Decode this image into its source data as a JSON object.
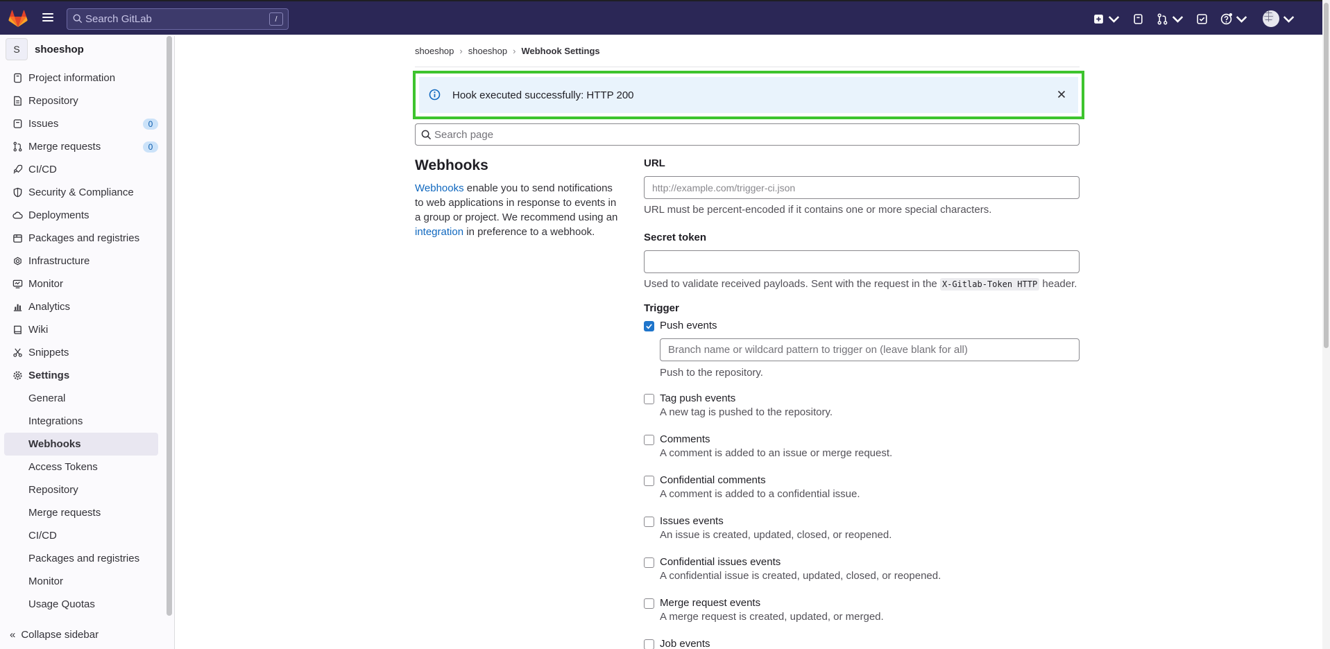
{
  "topbar": {
    "search_placeholder": "Search GitLab",
    "search_shortcut": "/"
  },
  "sidebar": {
    "project_avatar": "S",
    "project_name": "shoeshop",
    "items": [
      {
        "label": "Project information",
        "icon": "project-icon"
      },
      {
        "label": "Repository",
        "icon": "doc-icon"
      },
      {
        "label": "Issues",
        "icon": "issues-icon",
        "badge": "0"
      },
      {
        "label": "Merge requests",
        "icon": "merge-request-icon",
        "badge": "0"
      },
      {
        "label": "CI/CD",
        "icon": "rocket-icon"
      },
      {
        "label": "Security & Compliance",
        "icon": "shield-icon"
      },
      {
        "label": "Deployments",
        "icon": "cloud-icon"
      },
      {
        "label": "Packages and registries",
        "icon": "package-icon"
      },
      {
        "label": "Infrastructure",
        "icon": "infrastructure-icon"
      },
      {
        "label": "Monitor",
        "icon": "monitor-icon"
      },
      {
        "label": "Analytics",
        "icon": "chart-icon"
      },
      {
        "label": "Wiki",
        "icon": "book-icon"
      },
      {
        "label": "Snippets",
        "icon": "scissors-icon"
      },
      {
        "label": "Settings",
        "icon": "gear-icon"
      }
    ],
    "settings_sub": [
      "General",
      "Integrations",
      "Webhooks",
      "Access Tokens",
      "Repository",
      "Merge requests",
      "CI/CD",
      "Packages and registries",
      "Monitor",
      "Usage Quotas"
    ],
    "collapse_label": "Collapse sidebar"
  },
  "breadcrumb": {
    "items": [
      "shoeshop",
      "shoeshop",
      "Webhook Settings"
    ]
  },
  "alert": {
    "message": "Hook executed successfully: HTTP 200"
  },
  "page_search": {
    "placeholder": "Search page"
  },
  "intro": {
    "title": "Webhooks",
    "link1": "Webhooks",
    "text1": " enable you to send notifications to web applications in response to events in a group or project. We recommend using an ",
    "link2": "integration",
    "text2": " in preference to a webhook."
  },
  "form": {
    "url_label": "URL",
    "url_placeholder": "http://example.com/trigger-ci.json",
    "url_help": "URL must be percent-encoded if it contains one or more special characters.",
    "token_label": "Secret token",
    "token_help_pre": "Used to validate received payloads. Sent with the request in the",
    "token_help_code": "X-Gitlab-Token HTTP",
    "token_help_post": "header.",
    "trigger_label": "Trigger",
    "push_title": "Push events",
    "push_branch_placeholder": "Branch name or wildcard pattern to trigger on (leave blank for all)",
    "push_desc": "Push to the repository.",
    "events": [
      {
        "title": "Tag push events",
        "desc": "A new tag is pushed to the repository.",
        "checked": false
      },
      {
        "title": "Comments",
        "desc": "A comment is added to an issue or merge request.",
        "checked": false
      },
      {
        "title": "Confidential comments",
        "desc": "A comment is added to a confidential issue.",
        "checked": false
      },
      {
        "title": "Issues events",
        "desc": "An issue is created, updated, closed, or reopened.",
        "checked": false
      },
      {
        "title": "Confidential issues events",
        "desc": "A confidential issue is created, updated, closed, or reopened.",
        "checked": false
      },
      {
        "title": "Merge request events",
        "desc": "A merge request is created, updated, or merged.",
        "checked": false
      },
      {
        "title": "Job events",
        "desc": "",
        "checked": false
      }
    ]
  },
  "colors": {
    "topbar": "#2b2756",
    "accent": "#1f75cb",
    "alert_bg": "#e9f3fc",
    "highlight": "#3ec42e"
  }
}
